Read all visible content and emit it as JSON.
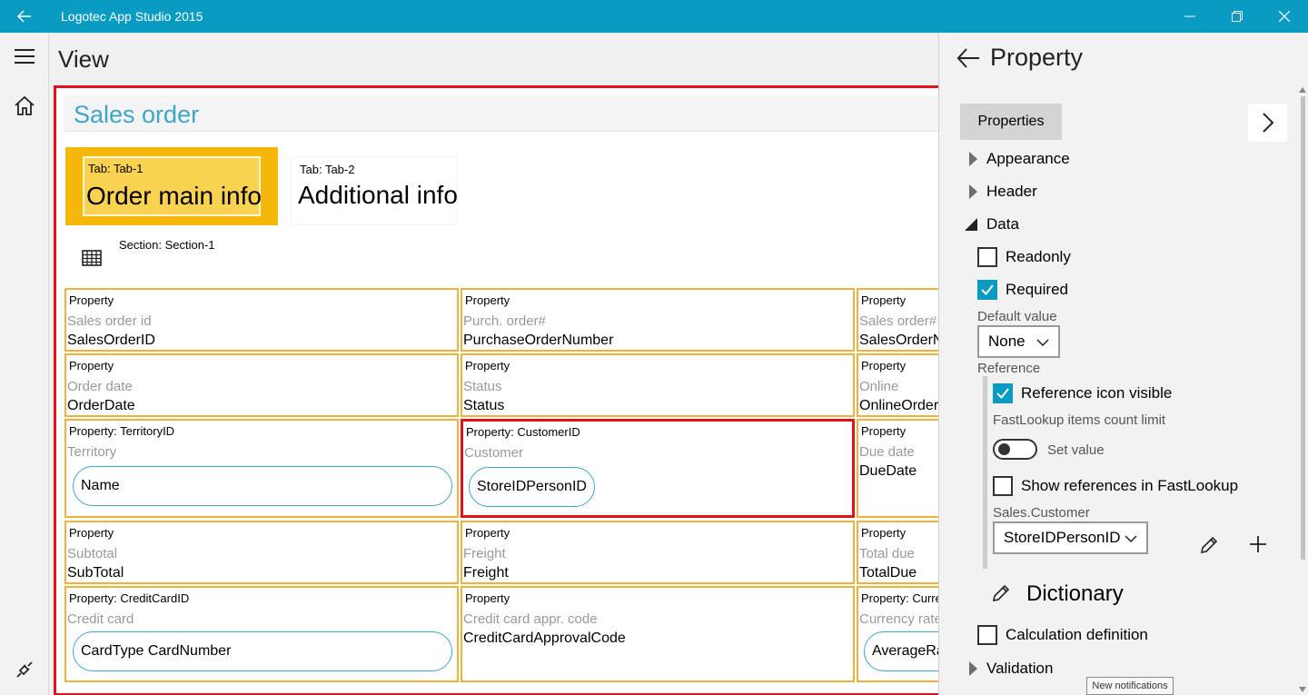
{
  "app": {
    "title": "Logotec App Studio 2015"
  },
  "view": {
    "title": "View"
  },
  "form": {
    "title": "Sales order",
    "tabs": [
      {
        "caption": "Tab: Tab-1",
        "name": "Order main info"
      },
      {
        "caption": "Tab: Tab-2",
        "name": "Additional info"
      }
    ],
    "section": "Section: Section-1",
    "cells": {
      "r1c1": {
        "caption": "Property",
        "label": "Sales order id",
        "value": "SalesOrderID"
      },
      "r1c2": {
        "caption": "Property",
        "label": "Purch. order#",
        "value": "PurchaseOrderNumber"
      },
      "r1c3": {
        "caption": "Property",
        "label": "Sales order#",
        "value": "SalesOrderN"
      },
      "r2c1": {
        "caption": "Property",
        "label": "Order date",
        "value": "OrderDate"
      },
      "r2c2": {
        "caption": "Property",
        "label": "Status",
        "value": "Status"
      },
      "r2c3": {
        "caption": "Property",
        "label": "Online",
        "value": "OnlineOrder"
      },
      "r3c1": {
        "caption": "Property: TerritoryID",
        "label": "Territory",
        "pill": "Name"
      },
      "r3c2": {
        "caption": "Property: CustomerID",
        "label": "Customer",
        "pill": "StoreIDPersonID"
      },
      "r3c3": {
        "caption": "Property",
        "label": "Due date",
        "value": "DueDate"
      },
      "r4c1": {
        "caption": "Property",
        "label": "Subtotal",
        "value": "SubTotal"
      },
      "r4c2": {
        "caption": "Property",
        "label": "Freight",
        "value": "Freight"
      },
      "r4c3": {
        "caption": "Property",
        "label": "Total due",
        "value": "TotalDue"
      },
      "r5c1": {
        "caption": "Property: CreditCardID",
        "label": "Credit card",
        "pill": "CardType CardNumber"
      },
      "r5c2": {
        "caption": "Property",
        "label": "Credit card appr. code",
        "value": "CreditCardApprovalCode"
      },
      "r5c3": {
        "caption": "Property: Curre",
        "label": "Currency rate",
        "pill": "AverageRa"
      }
    }
  },
  "panel": {
    "title": "Property",
    "tab": "Properties",
    "groups": {
      "appearance": "Appearance",
      "header": "Header",
      "data": "Data",
      "validation": "Validation"
    },
    "readonly": "Readonly",
    "required": "Required",
    "default_value_label": "Default value",
    "default_value": "None",
    "reference_label": "Reference",
    "reference_icon_visible": "Reference icon visible",
    "fastlookup_limit": "FastLookup items count limit",
    "set_value": "Set value",
    "show_refs": "Show references in FastLookup",
    "ref_entity": "Sales.Customer",
    "ref_field": "StoreIDPersonID",
    "dictionary": "Dictionary",
    "calc_def": "Calculation definition"
  },
  "tooltip": "New notifications",
  "colors": {
    "accent": "#0a9bc2",
    "selection": "#e3111b",
    "tab_active": "#f5b80a",
    "cell_border": "#f0b03c"
  }
}
